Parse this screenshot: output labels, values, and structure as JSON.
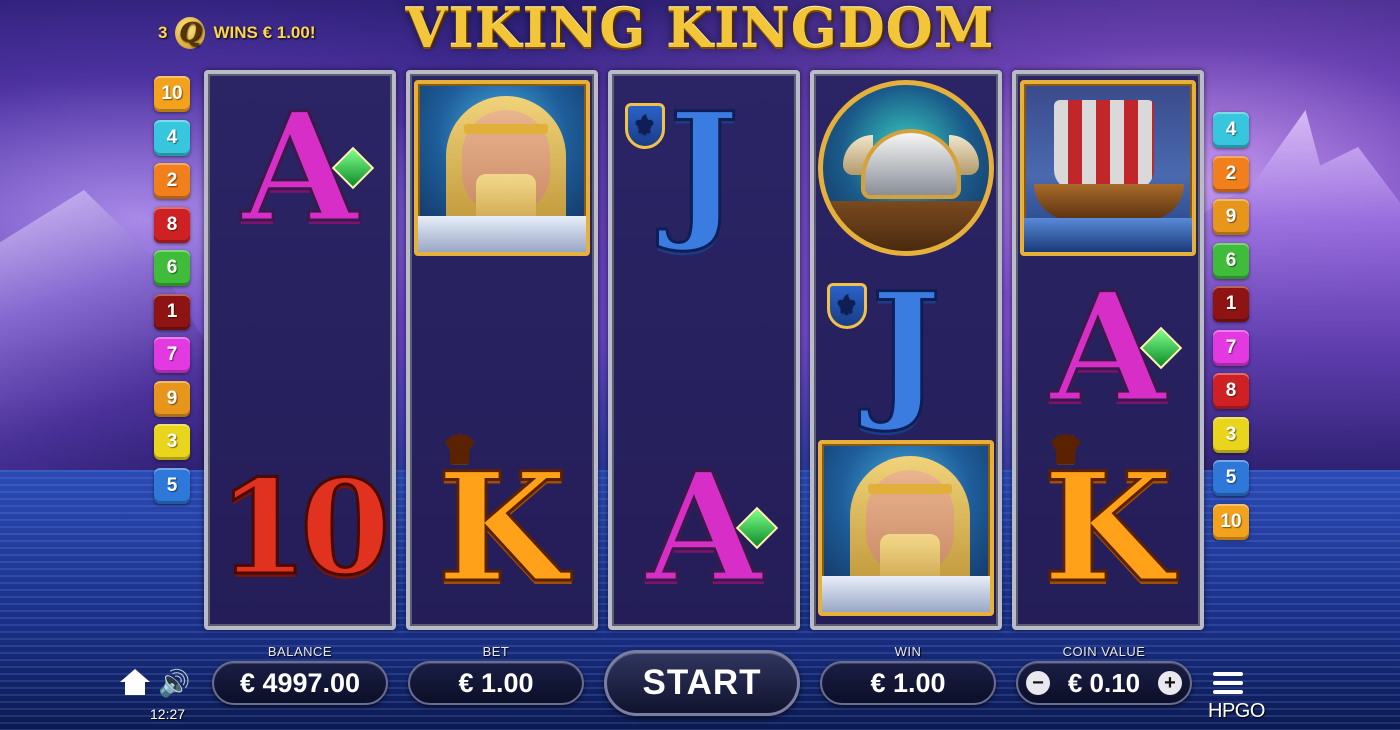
{
  "game": {
    "title": "VIKING KINGDOM",
    "brand": "HPGO",
    "time": "12:27"
  },
  "win_message": {
    "count": "3",
    "symbol": "Q",
    "text": "WINS € 1.00!"
  },
  "paylines_left": [
    {
      "n": "10",
      "color": "#f2a21c"
    },
    {
      "n": "4",
      "color": "#37c6de"
    },
    {
      "n": "2",
      "color": "#f07f1c"
    },
    {
      "n": "8",
      "color": "#cf2124"
    },
    {
      "n": "6",
      "color": "#3fbc3a"
    },
    {
      "n": "1",
      "color": "#8e1414"
    },
    {
      "n": "7",
      "color": "#e23ae0"
    },
    {
      "n": "9",
      "color": "#e8951c"
    },
    {
      "n": "3",
      "color": "#e8d51c"
    },
    {
      "n": "5",
      "color": "#2d78d8"
    }
  ],
  "paylines_right": [
    {
      "n": "4",
      "color": "#37c6de"
    },
    {
      "n": "2",
      "color": "#f07f1c"
    },
    {
      "n": "9",
      "color": "#e8951c"
    },
    {
      "n": "6",
      "color": "#3fbc3a"
    },
    {
      "n": "1",
      "color": "#8e1414"
    },
    {
      "n": "7",
      "color": "#e23ae0"
    },
    {
      "n": "8",
      "color": "#cf2124"
    },
    {
      "n": "3",
      "color": "#e8d51c"
    },
    {
      "n": "5",
      "color": "#2d78d8"
    },
    {
      "n": "10",
      "color": "#f2a21c"
    }
  ],
  "reels": [
    [
      "A",
      "",
      "10"
    ],
    [
      "viking-portrait",
      "",
      "K"
    ],
    [
      "J",
      "",
      "A"
    ],
    [
      "viking-helmet",
      "J",
      "viking-portrait"
    ],
    [
      "viking-ship",
      "A",
      "K"
    ]
  ],
  "controls": {
    "balance_label": "BALANCE",
    "balance_value": "€ 4997.00",
    "bet_label": "BET",
    "bet_value": "€ 1.00",
    "start_label": "START",
    "win_label": "WIN",
    "win_value": "€ 1.00",
    "coin_label": "COIN VALUE",
    "coin_value": "€ 0.10",
    "minus": "−",
    "plus": "+"
  },
  "icons": [
    "home-icon",
    "speaker-icon",
    "menu-icon",
    "gem-icon",
    "crown-icon",
    "shield-icon"
  ]
}
